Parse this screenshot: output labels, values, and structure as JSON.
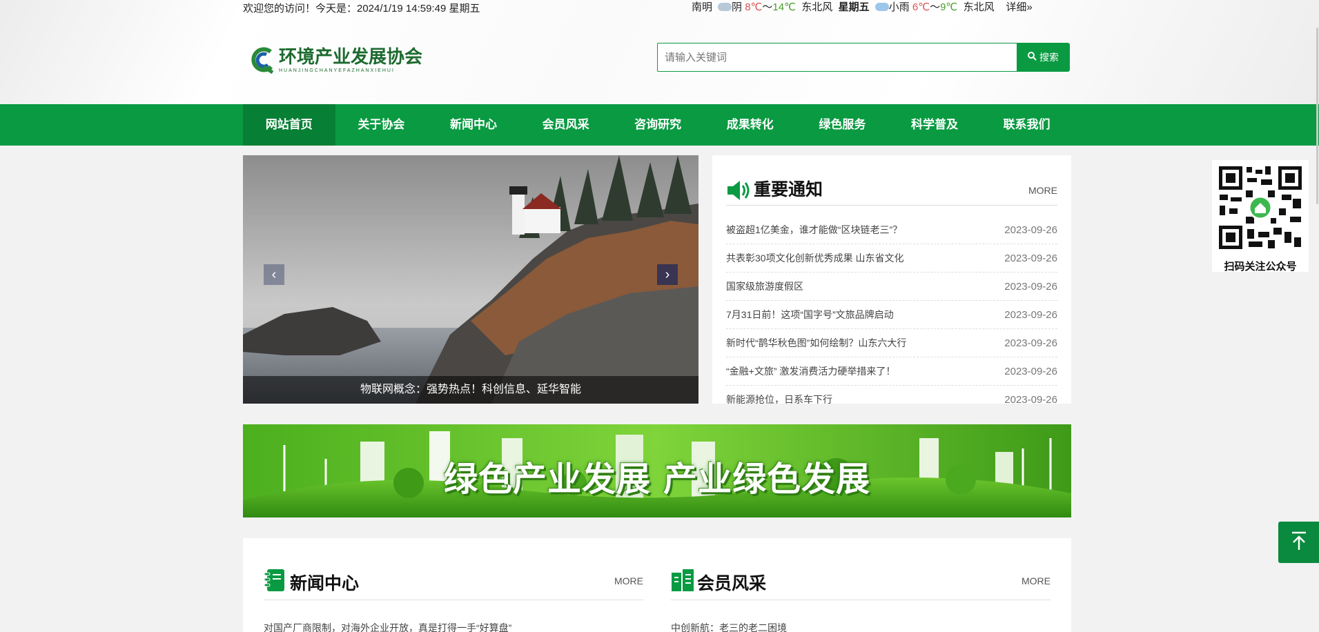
{
  "topbar": {
    "welcome": "欢迎您的访问！今天是：2024/1/19 14:59:49 星期五",
    "city": "南明",
    "today_weather": "阴",
    "today_high": "8℃",
    "today_sep": "～",
    "today_low": "14℃",
    "today_wind": "东北风",
    "tomorrow_label": "星期五",
    "tomorrow_weather": "小雨",
    "tomorrow_high": "6℃",
    "tomorrow_sep": "～",
    "tomorrow_low": "9℃",
    "tomorrow_wind": "东北风",
    "detail_link": "详细»"
  },
  "logo": {
    "cn": "环境产业发展协会",
    "en": "HUANJINGCHANYEFAZHANXIEHUI"
  },
  "search": {
    "placeholder": "请输入关键词",
    "button_label": "搜索"
  },
  "nav": {
    "items": [
      {
        "label": "网站首页"
      },
      {
        "label": "关于协会"
      },
      {
        "label": "新闻中心"
      },
      {
        "label": "会员风采"
      },
      {
        "label": "咨询研究"
      },
      {
        "label": "成果转化"
      },
      {
        "label": "绿色服务"
      },
      {
        "label": "科学普及"
      },
      {
        "label": "联系我们"
      }
    ]
  },
  "slider": {
    "caption": "物联网概念：强势热点！科创信息、延华智能",
    "prev": "‹",
    "next": "›"
  },
  "notice": {
    "title": "重要通知",
    "more": "MORE",
    "items": [
      {
        "title": "被盗超1亿美金，谁才能做“区块链老三”？",
        "date": "2023-09-26"
      },
      {
        "title": "共表彰30项文化创新优秀成果 山东省文化",
        "date": "2023-09-26"
      },
      {
        "title": "国家级旅游度假区",
        "date": "2023-09-26"
      },
      {
        "title": "7月31日前！这项“国字号”文旅品牌启动",
        "date": "2023-09-26"
      },
      {
        "title": "新时代“鹊华秋色图”如何绘制？山东六大行",
        "date": "2023-09-26"
      },
      {
        "title": "“金融+文旅” 激发消费活力硬举措来了！",
        "date": "2023-09-26"
      },
      {
        "title": "新能源抢位，日系车下行",
        "date": "2023-09-26"
      }
    ]
  },
  "banner": {
    "text": "绿色产业发展 产业绿色发展"
  },
  "news": {
    "title": "新闻中心",
    "more": "MORE",
    "first_item": "对国产厂商限制，对海外企业开放，真是打得一手“好算盘”"
  },
  "members": {
    "title": "会员风采",
    "more": "MORE",
    "first_item": "中创新航：老三的老二困境"
  },
  "qr": {
    "caption": "扫码关注公众号"
  },
  "totop": {
    "label": "↑"
  },
  "colors": {
    "primary": "#0a9a42",
    "primary_dark": "#077f35"
  }
}
